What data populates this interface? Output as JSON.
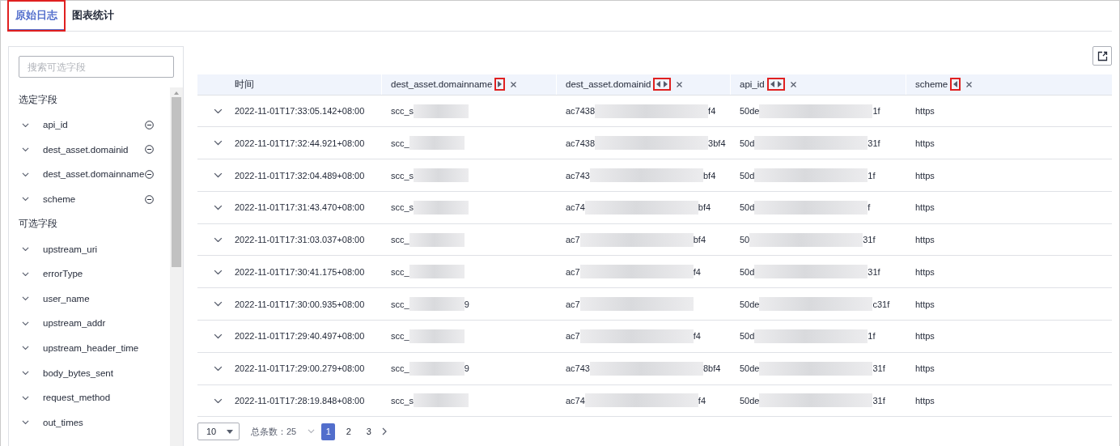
{
  "tabs": [
    {
      "label": "原始日志",
      "selected": true,
      "highlighted": true
    },
    {
      "label": "图表统计",
      "selected": false,
      "highlighted": false
    }
  ],
  "sidebar": {
    "search": {
      "placeholder": "搜索可选字段"
    },
    "sections": [
      {
        "title": "选定字段",
        "items": [
          {
            "label": "api_id",
            "kind": "selected"
          },
          {
            "label": "dest_asset.domainid",
            "kind": "selected"
          },
          {
            "label": "dest_asset.domainname",
            "kind": "selected"
          },
          {
            "label": "scheme",
            "kind": "selected"
          }
        ]
      },
      {
        "title": "可选字段",
        "items": [
          {
            "label": "upstream_uri",
            "kind": "available"
          },
          {
            "label": "errorType",
            "kind": "available"
          },
          {
            "label": "user_name",
            "kind": "available"
          },
          {
            "label": "upstream_addr",
            "kind": "available"
          },
          {
            "label": "upstream_header_time",
            "kind": "available"
          },
          {
            "label": "body_bytes_sent",
            "kind": "available"
          },
          {
            "label": "request_method",
            "kind": "available"
          },
          {
            "label": "out_times",
            "kind": "available"
          }
        ]
      }
    ]
  },
  "table": {
    "columns": [
      {
        "label": "时间"
      },
      {
        "label": "dest_asset.domainname",
        "move_left": false,
        "move_right": true,
        "removable": true,
        "highlighted": true
      },
      {
        "label": "dest_asset.domainid",
        "move_left": true,
        "move_right": true,
        "removable": true,
        "highlighted": true
      },
      {
        "label": "api_id",
        "move_left": true,
        "move_right": true,
        "removable": true,
        "highlighted": true
      },
      {
        "label": "scheme",
        "move_left": true,
        "move_right": false,
        "removable": true,
        "highlighted": true
      }
    ],
    "rows": [
      {
        "cells": [
          {
            "start": "2022-11-01T17:33:05.142+08:00"
          },
          {
            "start": "scc_s",
            "redacted": true
          },
          {
            "start": "ac7438",
            "end": "f4",
            "redacted": true
          },
          {
            "start": "50de",
            "end": "1f",
            "redacted": true
          },
          {
            "start": "https"
          }
        ]
      },
      {
        "cells": [
          {
            "start": "2022-11-01T17:32:44.921+08:00"
          },
          {
            "start": "scc_",
            "redacted": true
          },
          {
            "start": "ac7438",
            "end": "3bf4",
            "redacted": true
          },
          {
            "start": "50d",
            "end": "31f",
            "redacted": true
          },
          {
            "start": "https"
          }
        ]
      },
      {
        "cells": [
          {
            "start": "2022-11-01T17:32:04.489+08:00"
          },
          {
            "start": "scc_s",
            "redacted": true
          },
          {
            "start": "ac743",
            "end": "bf4",
            "redacted": true
          },
          {
            "start": "50d",
            "end": "1f",
            "redacted": true
          },
          {
            "start": "https"
          }
        ]
      },
      {
        "cells": [
          {
            "start": "2022-11-01T17:31:43.470+08:00"
          },
          {
            "start": "scc_s",
            "redacted": true
          },
          {
            "start": "ac74",
            "end": "bf4",
            "redacted": true
          },
          {
            "start": "50d",
            "end": "f",
            "redacted": true
          },
          {
            "start": "https"
          }
        ]
      },
      {
        "cells": [
          {
            "start": "2022-11-01T17:31:03.037+08:00"
          },
          {
            "start": "scc_",
            "redacted": true
          },
          {
            "start": "ac7",
            "end": "bf4",
            "redacted": true
          },
          {
            "start": "50",
            "end": "31f",
            "redacted": true
          },
          {
            "start": "https"
          }
        ]
      },
      {
        "cells": [
          {
            "start": "2022-11-01T17:30:41.175+08:00"
          },
          {
            "start": "scc_",
            "redacted": true
          },
          {
            "start": "ac7",
            "end": "f4",
            "redacted": true
          },
          {
            "start": "50d",
            "end": "31f",
            "redacted": true
          },
          {
            "start": "https"
          }
        ]
      },
      {
        "cells": [
          {
            "start": "2022-11-01T17:30:00.935+08:00"
          },
          {
            "start": "scc_",
            "end": "9",
            "redacted": true
          },
          {
            "start": "ac7",
            "redacted": true
          },
          {
            "start": "50de",
            "end": "c31f",
            "redacted": true
          },
          {
            "start": "https"
          }
        ]
      },
      {
        "cells": [
          {
            "start": "2022-11-01T17:29:40.497+08:00"
          },
          {
            "start": "scc_",
            "redacted": true
          },
          {
            "start": "ac7",
            "end": "f4",
            "redacted": true
          },
          {
            "start": "50d",
            "end": "1f",
            "redacted": true
          },
          {
            "start": "https"
          }
        ]
      },
      {
        "cells": [
          {
            "start": "2022-11-01T17:29:00.279+08:00"
          },
          {
            "start": "scc_",
            "end": "9",
            "redacted": true
          },
          {
            "start": "ac743",
            "end": "8bf4",
            "redacted": true
          },
          {
            "start": "50de",
            "end": "31f",
            "redacted": true
          },
          {
            "start": "https"
          }
        ]
      },
      {
        "cells": [
          {
            "start": "2022-11-01T17:28:19.848+08:00"
          },
          {
            "start": "scc_s",
            "redacted": true
          },
          {
            "start": "ac74",
            "end": "f4",
            "redacted": true
          },
          {
            "start": "50de",
            "end": "31f",
            "redacted": true
          },
          {
            "start": "https"
          }
        ]
      }
    ]
  },
  "pagination": {
    "page_size": "10",
    "total_label": "总条数：25",
    "pages": [
      {
        "label": "1",
        "selected": true
      },
      {
        "label": "2",
        "selected": false
      },
      {
        "label": "3",
        "selected": false
      }
    ]
  }
}
